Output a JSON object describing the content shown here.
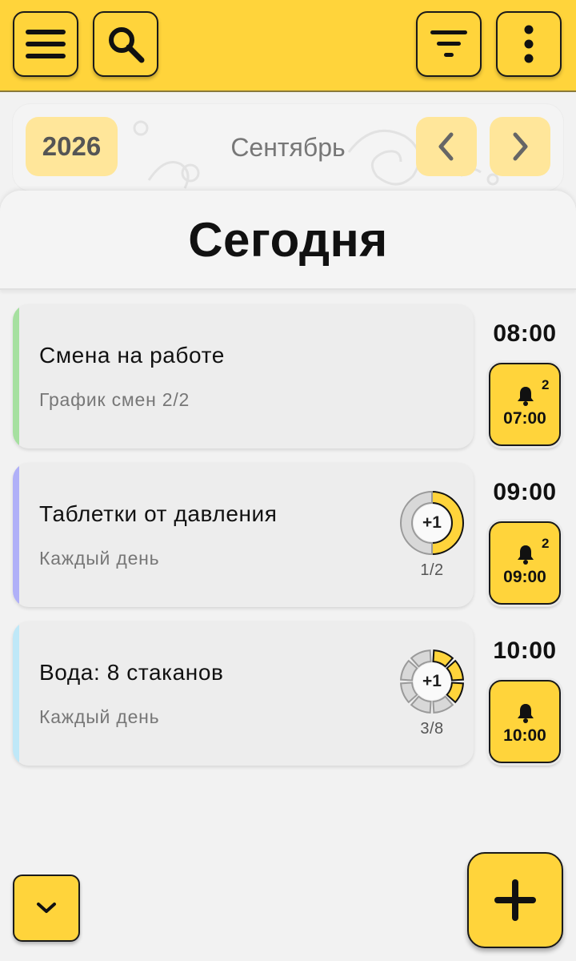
{
  "toolbar": {
    "menu_icon": "menu-icon",
    "search_icon": "search-icon",
    "filter_icon": "filter-icon",
    "more_icon": "more-vert-icon",
    "color": "#ffd43b"
  },
  "calendar": {
    "year": "2026",
    "month": "Сентябрь",
    "prev_icon": "chevron-left-icon",
    "next_icon": "chevron-right-icon"
  },
  "day": {
    "title": "Сегодня"
  },
  "events": [
    {
      "title": "Смена на работе",
      "subtitle": "График смен 2/2",
      "accent_color": "#a6e0a0",
      "time": "08:00",
      "alarm": {
        "count": "2",
        "time": "07:00"
      }
    },
    {
      "title": "Таблетки от давления",
      "subtitle": "Каждый день",
      "accent_color": "#b0b0f8",
      "progress": {
        "label": "+1",
        "count": "1/2",
        "done": 1,
        "total": 2
      },
      "time": "09:00",
      "alarm": {
        "count": "2",
        "time": "09:00"
      }
    },
    {
      "title": "Вода: 8 стаканов",
      "subtitle": "Каждый день",
      "accent_color": "#bfe8f8",
      "progress": {
        "label": "+1",
        "count": "3/8",
        "done": 3,
        "total": 8
      },
      "time": "10:00",
      "alarm": {
        "count": "",
        "time": "10:00"
      }
    }
  ],
  "bottom": {
    "collapse_icon": "chevron-down-icon",
    "add_icon": "plus-icon"
  }
}
